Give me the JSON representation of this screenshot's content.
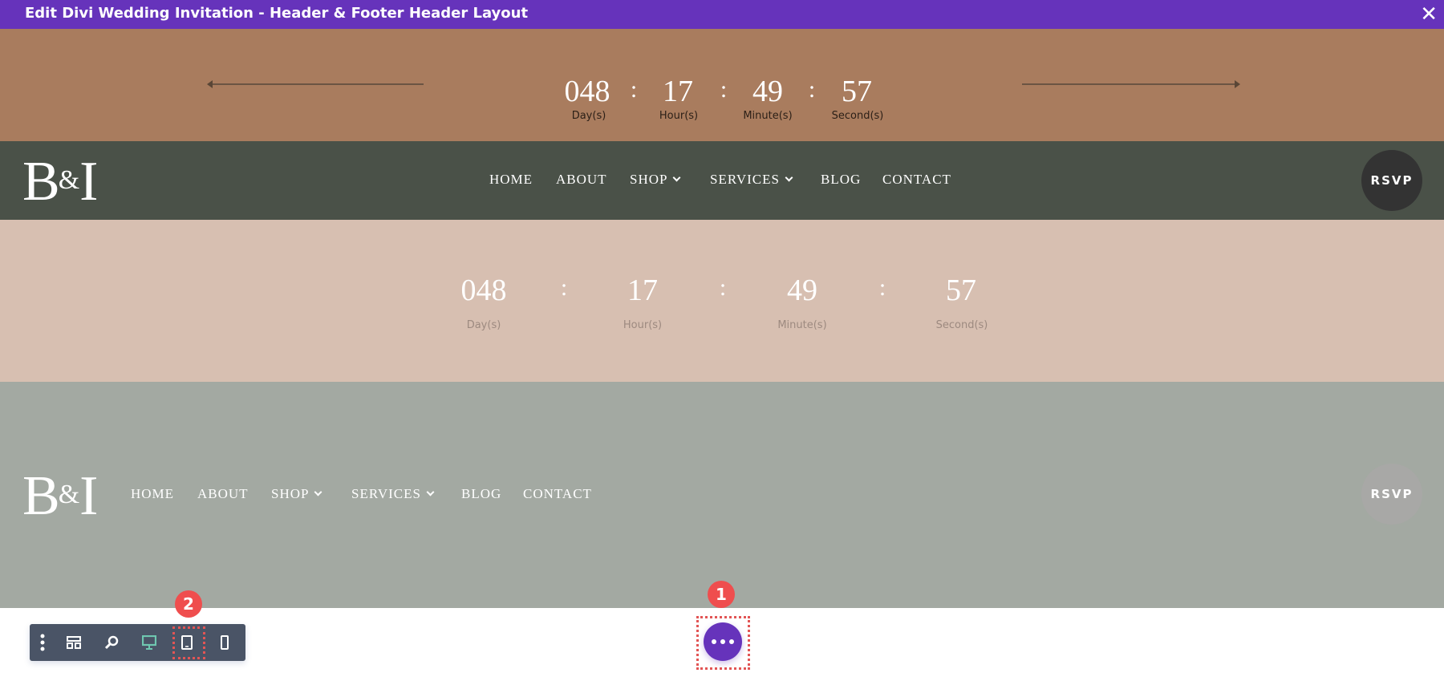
{
  "window": {
    "title": "Edit Divi Wedding Invitation - Header & Footer Header Layout",
    "close_icon": "close-icon"
  },
  "countdown": {
    "days": "048",
    "hours": "17",
    "minutes": "49",
    "seconds": "57",
    "days_label": "Day(s)",
    "hours_label": "Hour(s)",
    "minutes_label": "Minute(s)",
    "seconds_label": "Second(s)",
    "separator": ":"
  },
  "logo": {
    "text": "B&I"
  },
  "nav": {
    "items": [
      "HOME",
      "ABOUT",
      "SHOP",
      "SERVICES",
      "BLOG",
      "CONTACT"
    ]
  },
  "rsvp_label": "RSVP",
  "annotations": {
    "badge1": "1",
    "badge2": "2"
  },
  "toolbar": {
    "icons": [
      "menu-dots-icon",
      "wireframe-icon",
      "zoom-icon",
      "desktop-icon",
      "tablet-icon",
      "phone-icon"
    ],
    "active": "desktop"
  },
  "colors": {
    "titlebar": "#6633bb",
    "brown": "#a97c5e",
    "green": "#4a5148",
    "pink": "#d7bfb1",
    "grey": "#a3a9a2",
    "badge": "#ef4e4e"
  }
}
